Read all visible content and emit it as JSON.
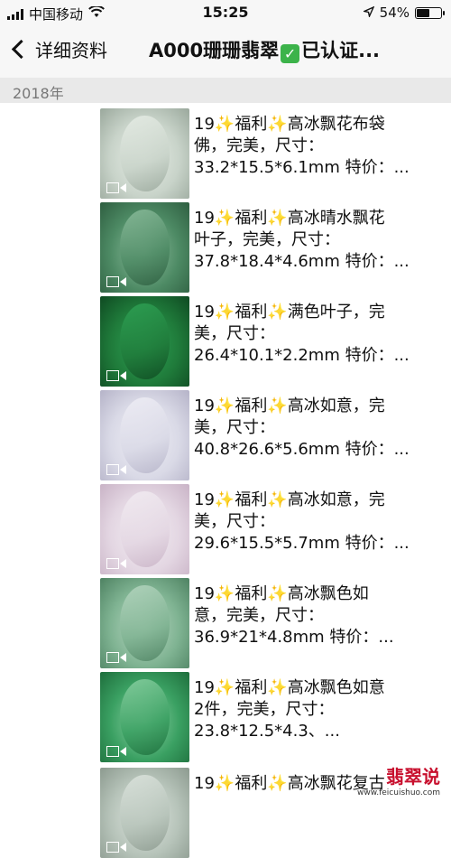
{
  "status": {
    "carrier": "中国移动",
    "time": "15:25",
    "battery": "54%",
    "battery_level": 0.54
  },
  "nav": {
    "back_label": "详细资料",
    "title": "A000珊珊翡翠",
    "title_suffix": "已认证..."
  },
  "section": {
    "year": "2018年"
  },
  "items": [
    {
      "lines": [
        "19✨福利✨高冰飘花布袋",
        "佛，完美，尺寸：",
        "33.2*15.5*6.1mm 特价：..."
      ],
      "thumb_colors": [
        "#c8d3c9",
        "#e8eee7",
        "#9aa89c"
      ]
    },
    {
      "lines": [
        "19✨福利✨高冰晴水飘花",
        "叶子，完美，尺寸：",
        "37.8*18.4*4.6mm 特价：..."
      ],
      "thumb_colors": [
        "#4d8a64",
        "#8fbf9f",
        "#2e5e40"
      ]
    },
    {
      "lines": [
        "19✨福利✨满色叶子，完",
        "美，尺寸：",
        "26.4*10.1*2.2mm 特价：..."
      ],
      "thumb_colors": [
        "#1f7a3a",
        "#2fa456",
        "#0f4a22"
      ]
    },
    {
      "lines": [
        "19✨福利✨高冰如意，完",
        "美，尺寸：",
        "40.8*26.6*5.6mm 特价：..."
      ],
      "thumb_colors": [
        "#d9d9e6",
        "#f0eff6",
        "#b5b3c8"
      ]
    },
    {
      "lines": [
        "19✨福利✨高冰如意，完",
        "美，尺寸：",
        "29.6*15.5*5.7mm 特价：..."
      ],
      "thumb_colors": [
        "#e3d6e2",
        "#f3eef3",
        "#c9b3c6"
      ]
    },
    {
      "lines": [
        "19✨福利✨高冰飘色如",
        "意，完美，尺寸：",
        "36.9*21*4.8mm 特价：..."
      ],
      "thumb_colors": [
        "#7fb392",
        "#b9d8c3",
        "#4e8262"
      ]
    },
    {
      "lines": [
        "19✨福利✨高冰飘色如意",
        "2件，完美，尺寸：",
        "23.8*12.5*4.3、..."
      ],
      "thumb_colors": [
        "#3aa062",
        "#8fd3a6",
        "#1e6e3c"
      ]
    },
    {
      "lines": [
        "19✨福利✨高冰飘花复古",
        "",
        ""
      ],
      "thumb_colors": [
        "#b6c3b9",
        "#dfe6e0",
        "#8c9a8f"
      ]
    }
  ],
  "watermark": {
    "text": "翡翠说",
    "sub": "www.feicuishuo.com"
  }
}
